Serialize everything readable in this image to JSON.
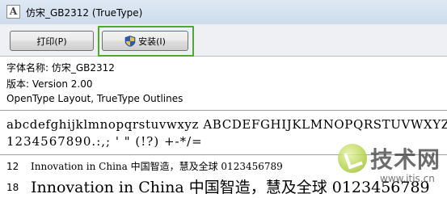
{
  "window": {
    "title": "仿宋_GB2312 (TrueType)"
  },
  "toolbar": {
    "print_label": "打印(P)",
    "install_label": "安装(I)"
  },
  "font_info": {
    "name_line": "字体名称: 仿宋_GB2312",
    "version_line": "版本: Version 2.00",
    "outline_line": "OpenType Layout, TrueType Outlines"
  },
  "samples": {
    "alphabet": "abcdefghijklmnopqrstuvwxyz ABCDEFGHIJKLMNOPQRSTUVWXYZ",
    "symbols": "1234567890.:,; ' \" (!?) +-*/=",
    "sizes": [
      {
        "size": "12",
        "text": "Innovation in China 中国智造，慧及全球 0123456789"
      },
      {
        "size": "18",
        "text": "Innovation in China 中国智造，慧及全球 0123456789"
      }
    ]
  },
  "watermark": {
    "text": "技术网",
    "url": "www.itjs.cn"
  },
  "colors": {
    "highlight_border": "#4cac2a",
    "titlebar": "#d6e2f0",
    "toolbar": "#eef0f3"
  },
  "icons": {
    "app": "font-file-icon",
    "install": "uac-shield-icon"
  }
}
